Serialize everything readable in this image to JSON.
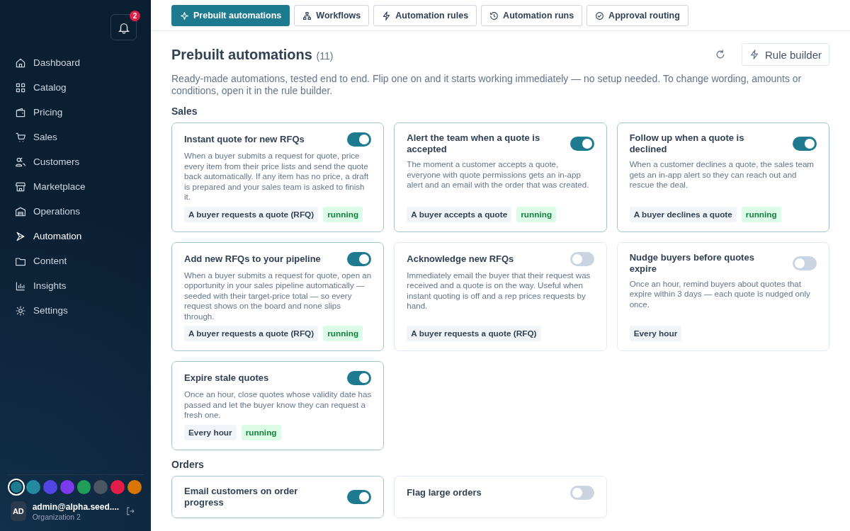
{
  "sidebar": {
    "notifications": {
      "count": "2"
    },
    "items": [
      {
        "label": "Dashboard",
        "selected": false
      },
      {
        "label": "Catalog",
        "selected": false
      },
      {
        "label": "Pricing",
        "selected": false
      },
      {
        "label": "Sales",
        "selected": false
      },
      {
        "label": "Customers",
        "selected": false
      },
      {
        "label": "Marketplace",
        "selected": false
      },
      {
        "label": "Operations",
        "selected": false
      },
      {
        "label": "Automation",
        "selected": true
      },
      {
        "label": "Content",
        "selected": false
      },
      {
        "label": "Insights",
        "selected": false
      },
      {
        "label": "Settings",
        "selected": false
      }
    ],
    "themes": [
      {
        "color": "#1e7b8f",
        "selected": true
      },
      {
        "color": "#238aa0",
        "selected": false
      },
      {
        "color": "#4f46e5",
        "selected": false
      },
      {
        "color": "#7c3aed",
        "selected": false
      },
      {
        "color": "#1f9d5a",
        "selected": false
      },
      {
        "color": "#4b5563",
        "selected": false
      },
      {
        "color": "#e11d48",
        "selected": false
      },
      {
        "color": "#d97706",
        "selected": false
      }
    ],
    "user": {
      "initials": "AD",
      "email": "admin@alpha.seed....",
      "org": "Organization 2"
    }
  },
  "tabs": [
    {
      "label": "Prebuilt automations",
      "selected": true
    },
    {
      "label": "Workflows",
      "selected": false
    },
    {
      "label": "Automation rules",
      "selected": false
    },
    {
      "label": "Automation runs",
      "selected": false
    },
    {
      "label": "Approval routing",
      "selected": false
    }
  ],
  "header": {
    "title": "Prebuilt automations",
    "count": "(11)",
    "button": "Rule builder",
    "description": "Ready-made automations, tested end to end. Flip one on and it starts working immediately — no setup needed. To change wording, amounts or conditions, open it in the rule builder."
  },
  "sections": [
    {
      "title": "Sales",
      "cards": [
        {
          "title": "Instant quote for new RFQs",
          "on": true,
          "description": "When a buyer submits a request for quote, price every item from their price lists and send the quote back automatically. If any item has no price, a draft is prepared and your sales team is asked to finish it.",
          "tags": [
            {
              "text": "A buyer requests a quote (RFQ)",
              "kind": "trigger"
            },
            {
              "text": "running",
              "kind": "status"
            }
          ]
        },
        {
          "title": "Alert the team when a quote is accepted",
          "on": true,
          "description": "The moment a customer accepts a quote, everyone with quote permissions gets an in-app alert and an email with the order that was created.",
          "tags": [
            {
              "text": "A buyer accepts a quote",
              "kind": "trigger"
            },
            {
              "text": "running",
              "kind": "status"
            }
          ]
        },
        {
          "title": "Follow up when a quote is declined",
          "on": true,
          "description": "When a customer declines a quote, the sales team gets an in-app alert so they can reach out and rescue the deal.",
          "tags": [
            {
              "text": "A buyer declines a quote",
              "kind": "trigger"
            },
            {
              "text": "running",
              "kind": "status"
            }
          ]
        },
        {
          "title": "Add new RFQs to your pipeline",
          "on": true,
          "description": "When a buyer submits a request for quote, open an opportunity in your sales pipeline automatically — seeded with their target-price total — so every request shows on the board and none slips through.",
          "tags": [
            {
              "text": "A buyer requests a quote (RFQ)",
              "kind": "trigger"
            },
            {
              "text": "running",
              "kind": "status"
            }
          ]
        },
        {
          "title": "Acknowledge new RFQs",
          "on": false,
          "description": "Immediately email the buyer that their request was received and a quote is on the way. Useful when instant quoting is off and a rep prices requests by hand.",
          "tags": [
            {
              "text": "A buyer requests a quote (RFQ)",
              "kind": "trigger"
            }
          ]
        },
        {
          "title": "Nudge buyers before quotes expire",
          "on": false,
          "description": "Once an hour, remind buyers about quotes that expire within 3 days — each quote is nudged only once.",
          "tags": [
            {
              "text": "Every hour",
              "kind": "trigger"
            }
          ]
        },
        {
          "title": "Expire stale quotes",
          "on": true,
          "description": "Once an hour, close quotes whose validity date has passed and let the buyer know they can request a fresh one.",
          "tags": [
            {
              "text": "Every hour",
              "kind": "trigger"
            },
            {
              "text": "running",
              "kind": "status"
            }
          ]
        }
      ]
    },
    {
      "title": "Orders",
      "cards": [
        {
          "title": "Email customers on order progress",
          "on": true
        },
        {
          "title": "Flag large orders",
          "on": false
        }
      ]
    }
  ]
}
